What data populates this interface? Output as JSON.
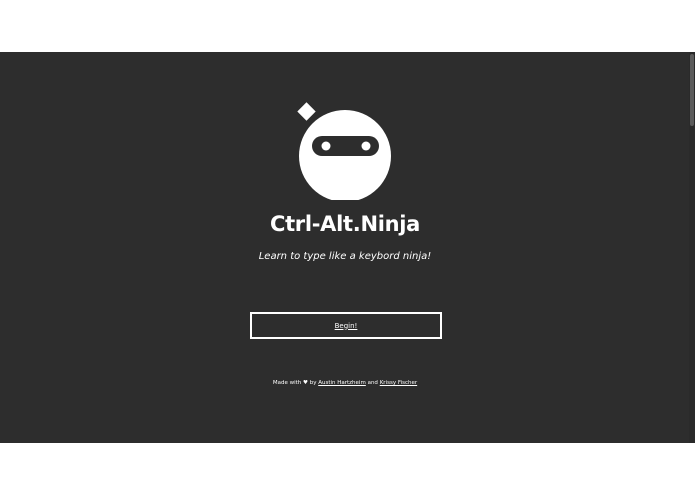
{
  "app": {
    "title": "Ctrl-Alt.Ninja",
    "tagline": "Learn to type like a keybord ninja!"
  },
  "actions": {
    "begin_label": "Begin!"
  },
  "footer": {
    "made_with": "Made with",
    "heart": "♥",
    "by": "by",
    "author_1": "Austin Hartzheim",
    "and": "and",
    "author_2": "Krissy Fischer"
  },
  "icons": {
    "logo": "ninja-head-icon",
    "heart": "heart-icon"
  },
  "colors": {
    "background": "#2d2d2d",
    "foreground": "#ffffff",
    "page_outside": "#ffffff"
  }
}
